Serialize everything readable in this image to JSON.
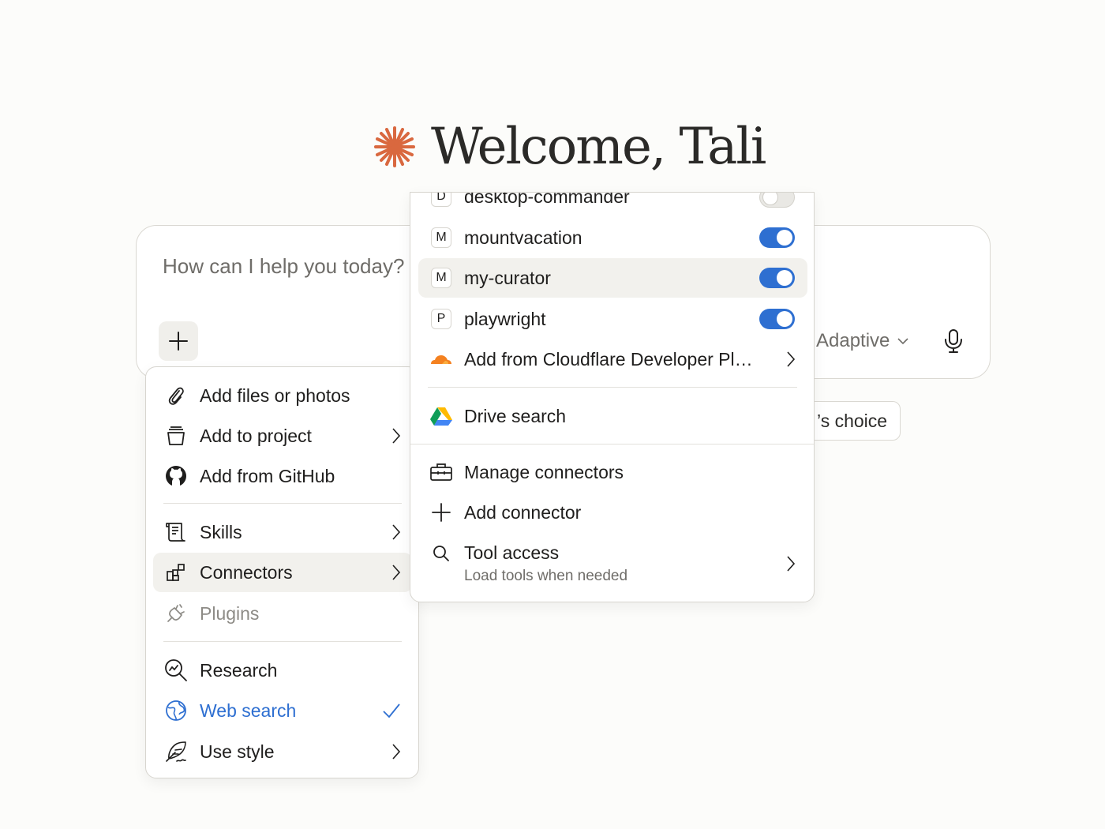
{
  "welcome": {
    "title": "Welcome, Tali",
    "accent_color": "#d9683f"
  },
  "composer": {
    "placeholder": "How can I help you today?",
    "model_label": "Adaptive",
    "chip_label": "’s choice"
  },
  "add_menu": {
    "items": [
      {
        "label": "Add files or photos",
        "icon": "paperclip-icon"
      },
      {
        "label": "Add to project",
        "icon": "project-box-icon",
        "has_submenu": true
      },
      {
        "label": "Add from GitHub",
        "icon": "github-icon"
      },
      {
        "label": "Skills",
        "icon": "scroll-icon",
        "has_submenu": true
      },
      {
        "label": "Connectors",
        "icon": "connectors-icon",
        "has_submenu": true,
        "highlighted": true
      },
      {
        "label": "Plugins",
        "icon": "plug-icon",
        "disabled": true
      },
      {
        "label": "Research",
        "icon": "research-icon"
      },
      {
        "label": "Web search",
        "icon": "globe-icon",
        "checked": true
      },
      {
        "label": "Use style",
        "icon": "feather-icon",
        "has_submenu": true
      }
    ]
  },
  "connectors_menu": {
    "connectors": [
      {
        "badge": "D",
        "label": "desktop-commander",
        "enabled": false
      },
      {
        "badge": "M",
        "label": "mountvacation",
        "enabled": true
      },
      {
        "badge": "M",
        "label": "my-curator",
        "enabled": true
      },
      {
        "badge": "P",
        "label": "playwright",
        "enabled": true
      }
    ],
    "cloudflare_label": "Add from Cloudflare Developer Pl…",
    "drive_label": "Drive search",
    "manage_label": "Manage connectors",
    "add_label": "Add connector",
    "tool_access_label": "Tool access",
    "tool_access_sub": "Load tools when needed",
    "toggle_on_color": "#2e6fd1"
  }
}
